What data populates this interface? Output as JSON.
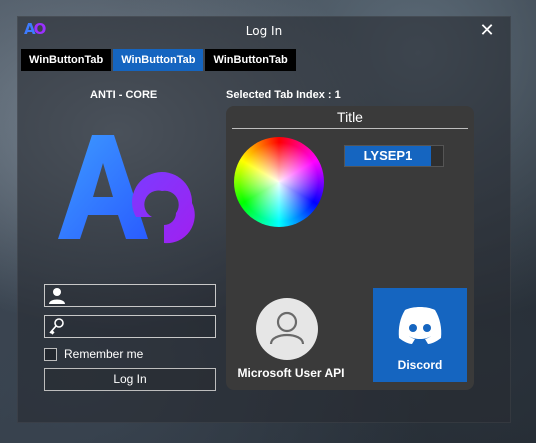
{
  "window": {
    "title": "Log In",
    "close_symbol": "✕",
    "logo_text_a": "A",
    "logo_text_o": "O"
  },
  "tabs": [
    {
      "label": "WinButtonTab",
      "active": false
    },
    {
      "label": "WinButtonTab",
      "active": true
    },
    {
      "label": "WinButtonTab",
      "active": false
    }
  ],
  "login": {
    "brand_label": "ANTI - CORE",
    "username": {
      "value": "",
      "placeholder": "",
      "icon": "user-icon"
    },
    "password": {
      "value": "",
      "placeholder": "",
      "icon": "key-icon"
    },
    "remember_label": "Remember me",
    "remember_checked": false,
    "login_button": "Log In"
  },
  "panel": {
    "selected_tab_text": "Selected Tab Index : 1",
    "title": "Title",
    "color_label": "LYSEP1",
    "user_api_label": "Microsoft User API",
    "discord_label": "Discord"
  },
  "colors": {
    "accent": "#1565c0",
    "logo_blue": "#3d7bff",
    "logo_purple": "#9b30ff",
    "panel_bg": "#3a3a3a"
  }
}
